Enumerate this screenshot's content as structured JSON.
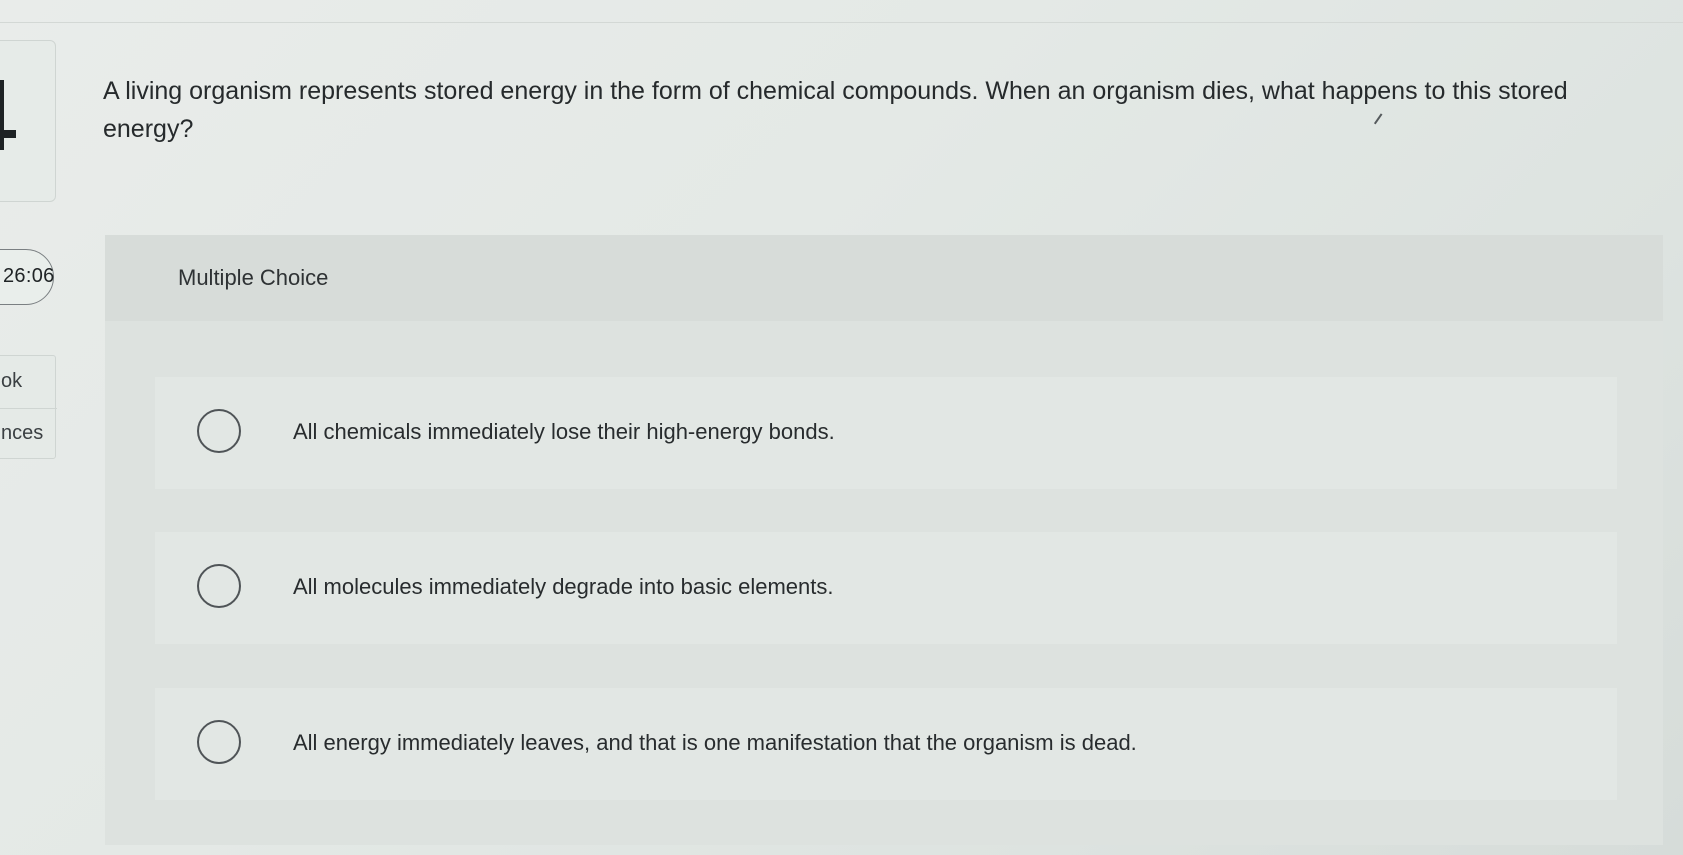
{
  "sidebar": {
    "timer": "26:06",
    "links": [
      "ok",
      "nces"
    ]
  },
  "question": {
    "text": "A living organism represents stored energy in the form of chemical compounds. When an organism dies, what happens to this stored energy?"
  },
  "answer_section": {
    "type_label": "Multiple Choice",
    "options": [
      {
        "text": "All chemicals immediately lose their high-energy bonds.",
        "selected": false
      },
      {
        "text": "All molecules immediately degrade into basic elements.",
        "selected": false
      },
      {
        "text": "All energy immediately leaves, and that is one manifestation that the organism is dead.",
        "selected": false
      }
    ]
  }
}
